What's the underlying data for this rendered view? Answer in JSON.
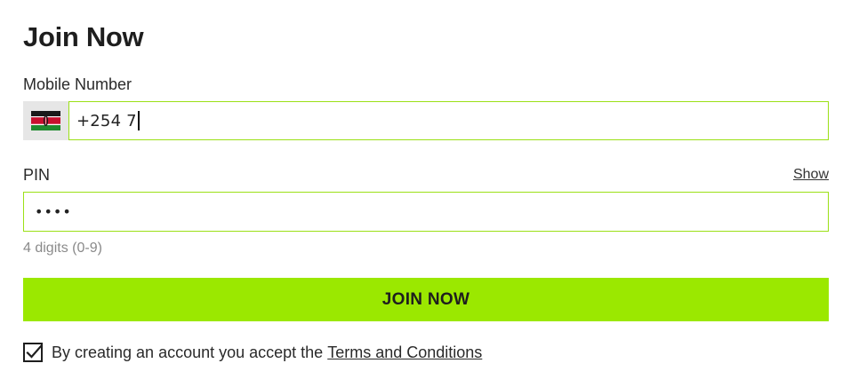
{
  "title": "Join Now",
  "mobile": {
    "label": "Mobile Number",
    "flag_icon": "kenya-flag-icon",
    "value": "+254 7"
  },
  "pin": {
    "label": "PIN",
    "show_label": "Show",
    "masked_value": "••••",
    "hint": "4 digits (0-9)"
  },
  "join_button_label": "JOIN NOW",
  "terms": {
    "checked": true,
    "text": "By creating an account you accept the",
    "link_text": "Terms and Conditions"
  },
  "colors": {
    "accent": "#9be800",
    "input_border": "#9be016",
    "hint": "#8a8a8a"
  }
}
